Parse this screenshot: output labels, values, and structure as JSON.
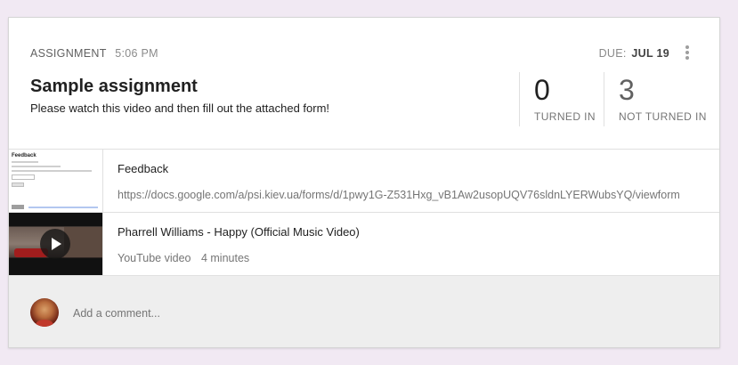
{
  "assignment": {
    "kind": "ASSIGNMENT",
    "time": "5:06 PM",
    "due_label": "DUE:",
    "due_value": "JUL 19",
    "title": "Sample assignment",
    "description": "Please watch this video and then fill out the attached form!",
    "menu_icon": "more-vert-icon"
  },
  "stats": {
    "turned_in": {
      "value": "0",
      "label": "TURNED IN"
    },
    "not_turned_in": {
      "value": "3",
      "label": "NOT TURNED IN"
    }
  },
  "attachments": [
    {
      "title": "Feedback",
      "subtitle": "https://docs.google.com/a/psi.kiev.ua/forms/d/1pwy1G-Z531Hxg_vB1Aw2usopUQV76sldnLYERWubsYQ/viewform",
      "thumb_title": "Feedback"
    },
    {
      "title": "Pharrell Williams - Happy (Official Music Video)",
      "source": "YouTube video",
      "duration": "4 minutes",
      "thumb_icon": "play-icon"
    }
  ],
  "comment": {
    "placeholder": "Add a comment..."
  },
  "colors": {
    "background": "#f1e9f3",
    "card": "#ffffff",
    "comment_bg": "#eeeeee"
  }
}
